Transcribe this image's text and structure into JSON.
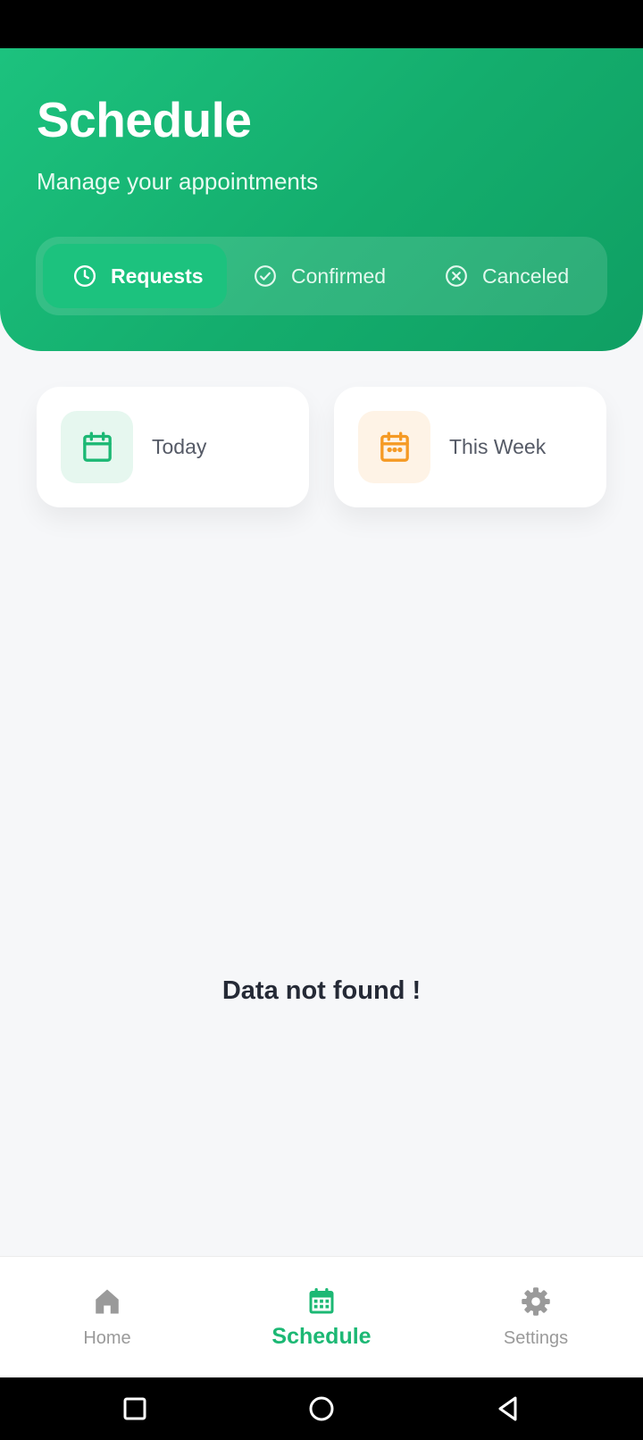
{
  "header": {
    "title": "Schedule",
    "subtitle": "Manage your appointments",
    "tabs": [
      {
        "label": "Requests",
        "icon": "clock-icon",
        "active": true
      },
      {
        "label": "Confirmed",
        "icon": "check-circle-icon",
        "active": false
      },
      {
        "label": "Canceled",
        "icon": "x-circle-icon",
        "active": false
      }
    ]
  },
  "filters": [
    {
      "label": "Today",
      "icon": "calendar-icon",
      "color": "#1cb874",
      "bg": "#e6f7ef"
    },
    {
      "label": "This Week",
      "icon": "calendar-week-icon",
      "color": "#f59a24",
      "bg": "#fef3e6"
    }
  ],
  "empty_message": "Data not found !",
  "bottom_nav": [
    {
      "label": "Home",
      "icon": "home-icon",
      "active": false
    },
    {
      "label": "Schedule",
      "icon": "calendar-grid-icon",
      "active": true
    },
    {
      "label": "Settings",
      "icon": "gear-icon",
      "active": false
    }
  ],
  "colors": {
    "primary": "#1cc27e",
    "accent_orange": "#f59a24",
    "background": "#f6f7f9",
    "inactive": "#9a9a9a"
  }
}
